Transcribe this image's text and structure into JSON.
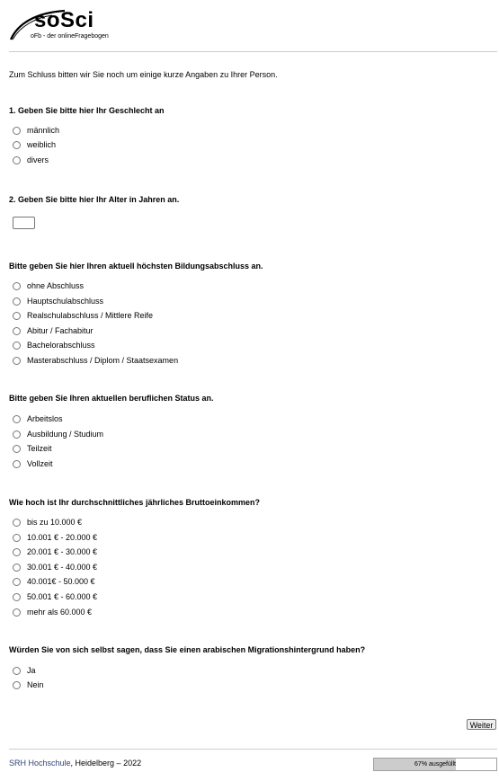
{
  "logo": {
    "word": "soSci",
    "tagline": "oFb - der onlineFragebogen"
  },
  "intro": "Zum Schluss bitten wir Sie noch um einige kurze Angaben zu Ihrer Person.",
  "q_gender": {
    "title": "1. Geben Sie bitte hier Ihr Geschlecht an",
    "options": [
      "männlich",
      "weiblich",
      "divers"
    ]
  },
  "q_age": {
    "title": "2. Geben Sie bitte hier Ihr Alter in Jahren an.",
    "value": ""
  },
  "q_education": {
    "title": "Bitte geben Sie hier Ihren aktuell höchsten Bildungsabschluss an.",
    "options": [
      "ohne Abschluss",
      "Hauptschulabschluss",
      "Realschulabschluss / Mittlere Reife",
      "Abitur / Fachabitur",
      "Bachelorabschluss",
      "Masterabschluss / Diplom / Staatsexamen"
    ]
  },
  "q_status": {
    "title": "Bitte geben Sie Ihren aktuellen beruflichen Status an.",
    "options": [
      "Arbeitslos",
      "Ausbildung / Studium",
      "Teilzeit",
      "Vollzeit"
    ]
  },
  "q_income": {
    "title": "Wie hoch ist Ihr durchschnittliches jährliches Bruttoeinkommen?",
    "options": [
      "bis zu 10.000 €",
      "10.001 € - 20.000 €",
      "20.001 € - 30.000 €",
      "30.001 € - 40.000 €",
      "40.001€ - 50.000 €",
      "50.001 € - 60.000 €",
      "mehr als 60.000 €"
    ]
  },
  "q_migration": {
    "title": "Würden Sie von sich selbst sagen, dass Sie einen arabischen Migrationshintergrund haben?",
    "options": [
      "Ja",
      "Nein"
    ]
  },
  "next_button": "Weiter",
  "footer": {
    "link": "SRH Hochschule",
    "rest": ", Heidelberg – 2022"
  },
  "progress": {
    "label": "67% ausgefüllt",
    "fraction": 0.67
  },
  "colors": {
    "link": "#334477",
    "progress_fill": "#cccccc"
  }
}
